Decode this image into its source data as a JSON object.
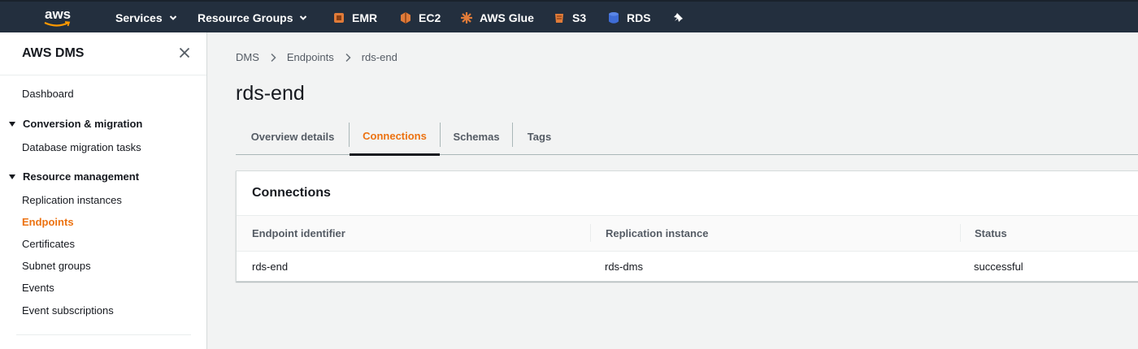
{
  "topnav": {
    "logo_text": "aws",
    "services_label": "Services",
    "resource_groups_label": "Resource Groups",
    "shortcuts": [
      {
        "label": "EMR",
        "icon": "emr-icon",
        "color": "#e07b39"
      },
      {
        "label": "EC2",
        "icon": "ec2-icon",
        "color": "#e07b39"
      },
      {
        "label": "AWS Glue",
        "icon": "aws-glue-icon",
        "color": "#e07b39"
      },
      {
        "label": "S3",
        "icon": "s3-icon",
        "color": "#e07b39"
      },
      {
        "label": "RDS",
        "icon": "rds-icon",
        "color": "#3f6dd6"
      }
    ],
    "pin_icon": "pin-icon"
  },
  "sidebar": {
    "title": "AWS DMS",
    "close_icon": "close-icon",
    "dashboard": "Dashboard",
    "section_conversion": "Conversion & migration",
    "migration_tasks": "Database migration tasks",
    "section_resource": "Resource management",
    "replication_instances": "Replication instances",
    "endpoints": "Endpoints",
    "certificates": "Certificates",
    "subnet_groups": "Subnet groups",
    "events": "Events",
    "event_subscriptions": "Event subscriptions"
  },
  "breadcrumb": {
    "root": "DMS",
    "parent": "Endpoints",
    "current": "rds-end"
  },
  "page": {
    "title": "rds-end"
  },
  "tabs": {
    "overview": "Overview details",
    "connections": "Connections",
    "schemas": "Schemas",
    "tags": "Tags",
    "active": "Connections"
  },
  "connections": {
    "title": "Connections",
    "columns": [
      "Endpoint identifier",
      "Replication instance",
      "Status"
    ],
    "rows": [
      {
        "endpoint": "rds-end",
        "instance": "rds-dms",
        "status": "successful"
      }
    ]
  },
  "colors": {
    "nav_bg": "#232f3e",
    "accent": "#ec7211"
  }
}
